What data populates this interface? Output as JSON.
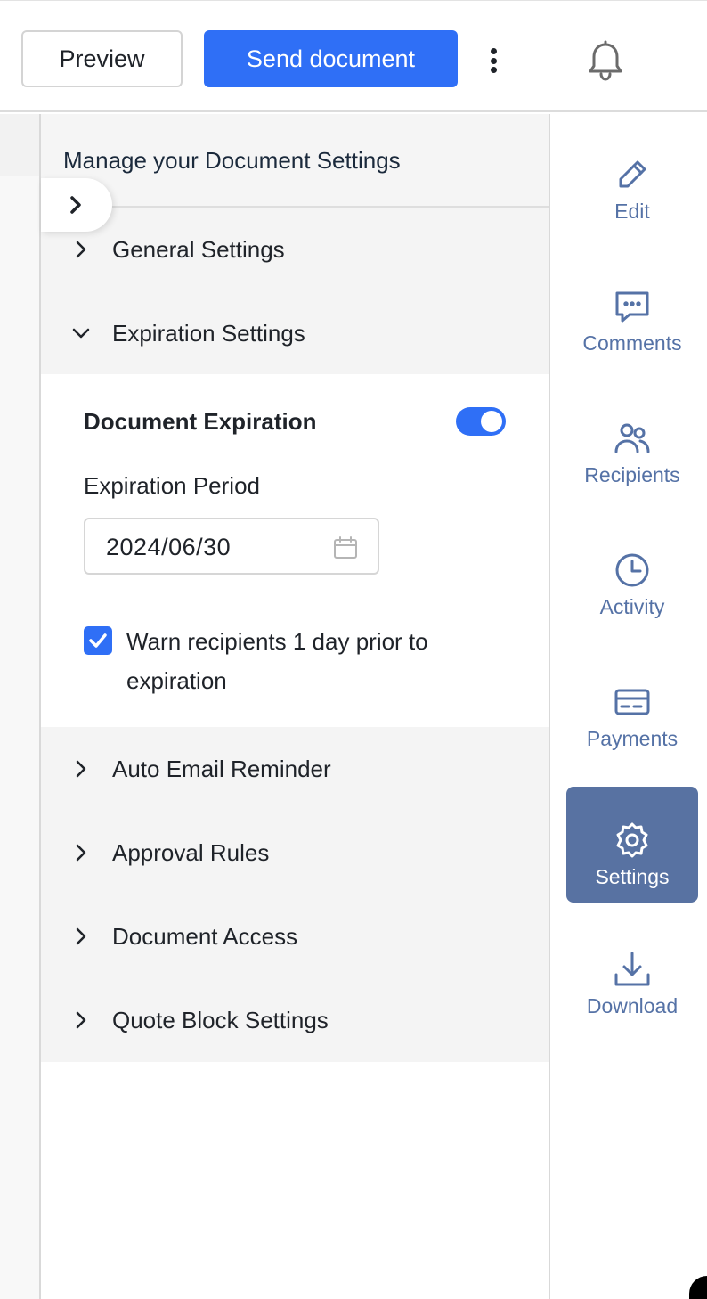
{
  "toolbar": {
    "preview_label": "Preview",
    "send_label": "Send document",
    "more_icon": "kebab-vertical-icon",
    "notifications_icon": "bell-icon"
  },
  "panel": {
    "title": "Manage your Document Settings",
    "sections": [
      {
        "label": "General Settings",
        "expanded": false
      },
      {
        "label": "Expiration Settings",
        "expanded": true
      },
      {
        "label": "Auto Email Reminder",
        "expanded": false
      },
      {
        "label": "Approval Rules",
        "expanded": false
      },
      {
        "label": "Document Access",
        "expanded": false
      },
      {
        "label": "Quote Block Settings",
        "expanded": false
      }
    ],
    "expiration": {
      "toggle_label": "Document Expiration",
      "toggle_on": true,
      "period_label": "Expiration Period",
      "date_value": "2024/06/30",
      "warn_checked": true,
      "warn_text": "Warn recipients 1 day prior to expiration"
    }
  },
  "sidebar": {
    "items": [
      {
        "label": "Edit",
        "icon": "pencil-icon"
      },
      {
        "label": "Comments",
        "icon": "comment-icon"
      },
      {
        "label": "Recipients",
        "icon": "users-icon"
      },
      {
        "label": "Activity",
        "icon": "clock-icon"
      },
      {
        "label": "Payments",
        "icon": "credit-card-icon"
      },
      {
        "label": "Settings",
        "icon": "gear-icon",
        "active": true
      },
      {
        "label": "Download",
        "icon": "download-icon"
      }
    ]
  },
  "colors": {
    "accent": "#2f6ff6",
    "sidebar_active": "#5872a2",
    "sidebar_text": "#5572a6"
  }
}
